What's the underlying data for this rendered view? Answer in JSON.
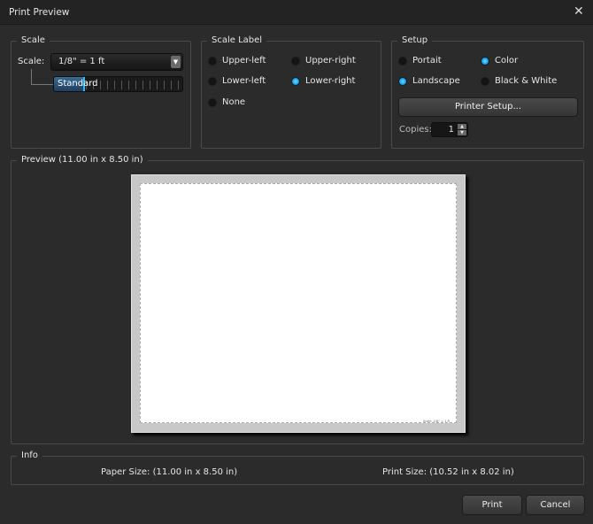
{
  "window": {
    "title": "Print Preview",
    "close": "✕"
  },
  "scale": {
    "legend": "Scale",
    "label": "Scale:",
    "value": "1/8\" = 1 ft",
    "slider_label": "Standard",
    "slider_position": 0.2
  },
  "scale_label": {
    "legend": "Scale Label",
    "options": [
      {
        "label": "Upper-left",
        "selected": false
      },
      {
        "label": "Upper-right",
        "selected": false
      },
      {
        "label": "Lower-left",
        "selected": false
      },
      {
        "label": "Lower-right",
        "selected": true
      },
      {
        "label": "None",
        "selected": false
      }
    ]
  },
  "setup": {
    "legend": "Setup",
    "portrait": "Portait",
    "color": "Color",
    "landscape": "Landscape",
    "bw": "Black & White",
    "printer_setup": "Printer Setup...",
    "copies_label": "Copies:",
    "copies": "1"
  },
  "preview": {
    "legend": "Preview (11.00 in x 8.50 in)",
    "page_label": "Scale: 1/8\" = 1 ft"
  },
  "info": {
    "legend": "Info",
    "paper_size": "Paper Size: (11.00 in x 8.50 in)",
    "print_size": "Print Size: (10.52 in x 8.02 in)"
  },
  "buttons": {
    "print": "Print",
    "cancel": "Cancel"
  }
}
